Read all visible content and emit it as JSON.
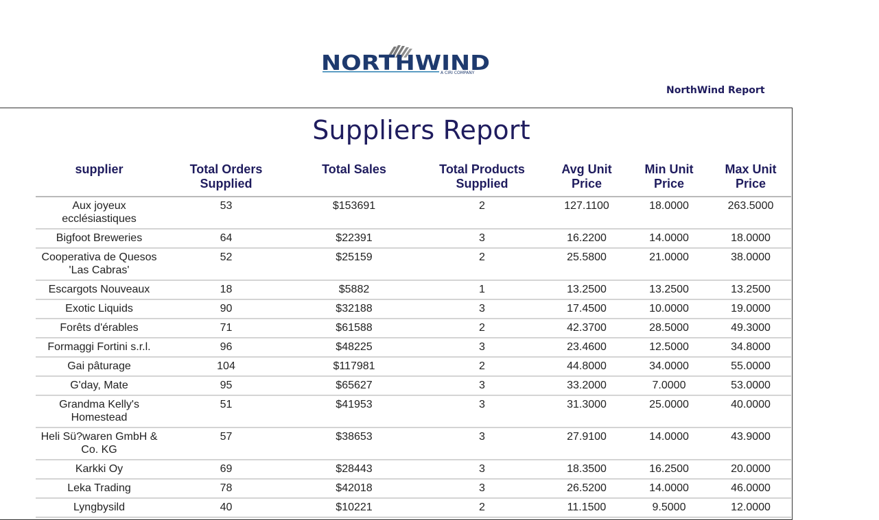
{
  "logo": {
    "wordmark": "NORTHWIND",
    "tagline": "A CIRI COMPANY",
    "colors": {
      "navy": "#1e3a6e",
      "teal": "#2a7fb0",
      "gray": "#7a7a7a"
    }
  },
  "report_label": "NorthWind Report",
  "title": "Suppliers Report",
  "colors": {
    "heading": "#1f1c5e",
    "text": "#222222",
    "rule": "#d4d4d4"
  },
  "columns": [
    "supplier",
    "Total Orders Supplied",
    "Total Sales",
    "Total Products Supplied",
    "Avg Unit Price",
    "Min Unit Price",
    "Max Unit Price"
  ],
  "rows": [
    [
      "Aux joyeux ecclésiastiques",
      "53",
      "$153691",
      "2",
      "127.1100",
      "18.0000",
      "263.5000"
    ],
    [
      "Bigfoot Breweries",
      "64",
      "$22391",
      "3",
      "16.2200",
      "14.0000",
      "18.0000"
    ],
    [
      "Cooperativa de Quesos 'Las Cabras'",
      "52",
      "$25159",
      "2",
      "25.5800",
      "21.0000",
      "38.0000"
    ],
    [
      "Escargots Nouveaux",
      "18",
      "$5882",
      "1",
      "13.2500",
      "13.2500",
      "13.2500"
    ],
    [
      "Exotic Liquids",
      "90",
      "$32188",
      "3",
      "17.4500",
      "10.0000",
      "19.0000"
    ],
    [
      "Forêts d'érables",
      "71",
      "$61588",
      "2",
      "42.3700",
      "28.5000",
      "49.3000"
    ],
    [
      "Formaggi Fortini s.r.l.",
      "96",
      "$48225",
      "3",
      "23.4600",
      "12.5000",
      "34.8000"
    ],
    [
      "Gai pâturage",
      "104",
      "$117981",
      "2",
      "44.8000",
      "34.0000",
      "55.0000"
    ],
    [
      "G'day, Mate",
      "95",
      "$65627",
      "3",
      "33.2000",
      "7.0000",
      "53.0000"
    ],
    [
      "Grandma Kelly's Homestead",
      "51",
      "$41953",
      "3",
      "31.3000",
      "25.0000",
      "40.0000"
    ],
    [
      "Heli Sü?waren GmbH & Co. KG",
      "57",
      "$38653",
      "3",
      "27.9100",
      "14.0000",
      "43.9000"
    ],
    [
      "Karkki Oy",
      "69",
      "$28443",
      "3",
      "18.3500",
      "16.2500",
      "20.0000"
    ],
    [
      "Leka Trading",
      "78",
      "$42018",
      "3",
      "26.5200",
      "14.0000",
      "46.0000"
    ],
    [
      "Lyngbysild",
      "40",
      "$10221",
      "2",
      "11.1500",
      "9.5000",
      "12.0000"
    ]
  ]
}
